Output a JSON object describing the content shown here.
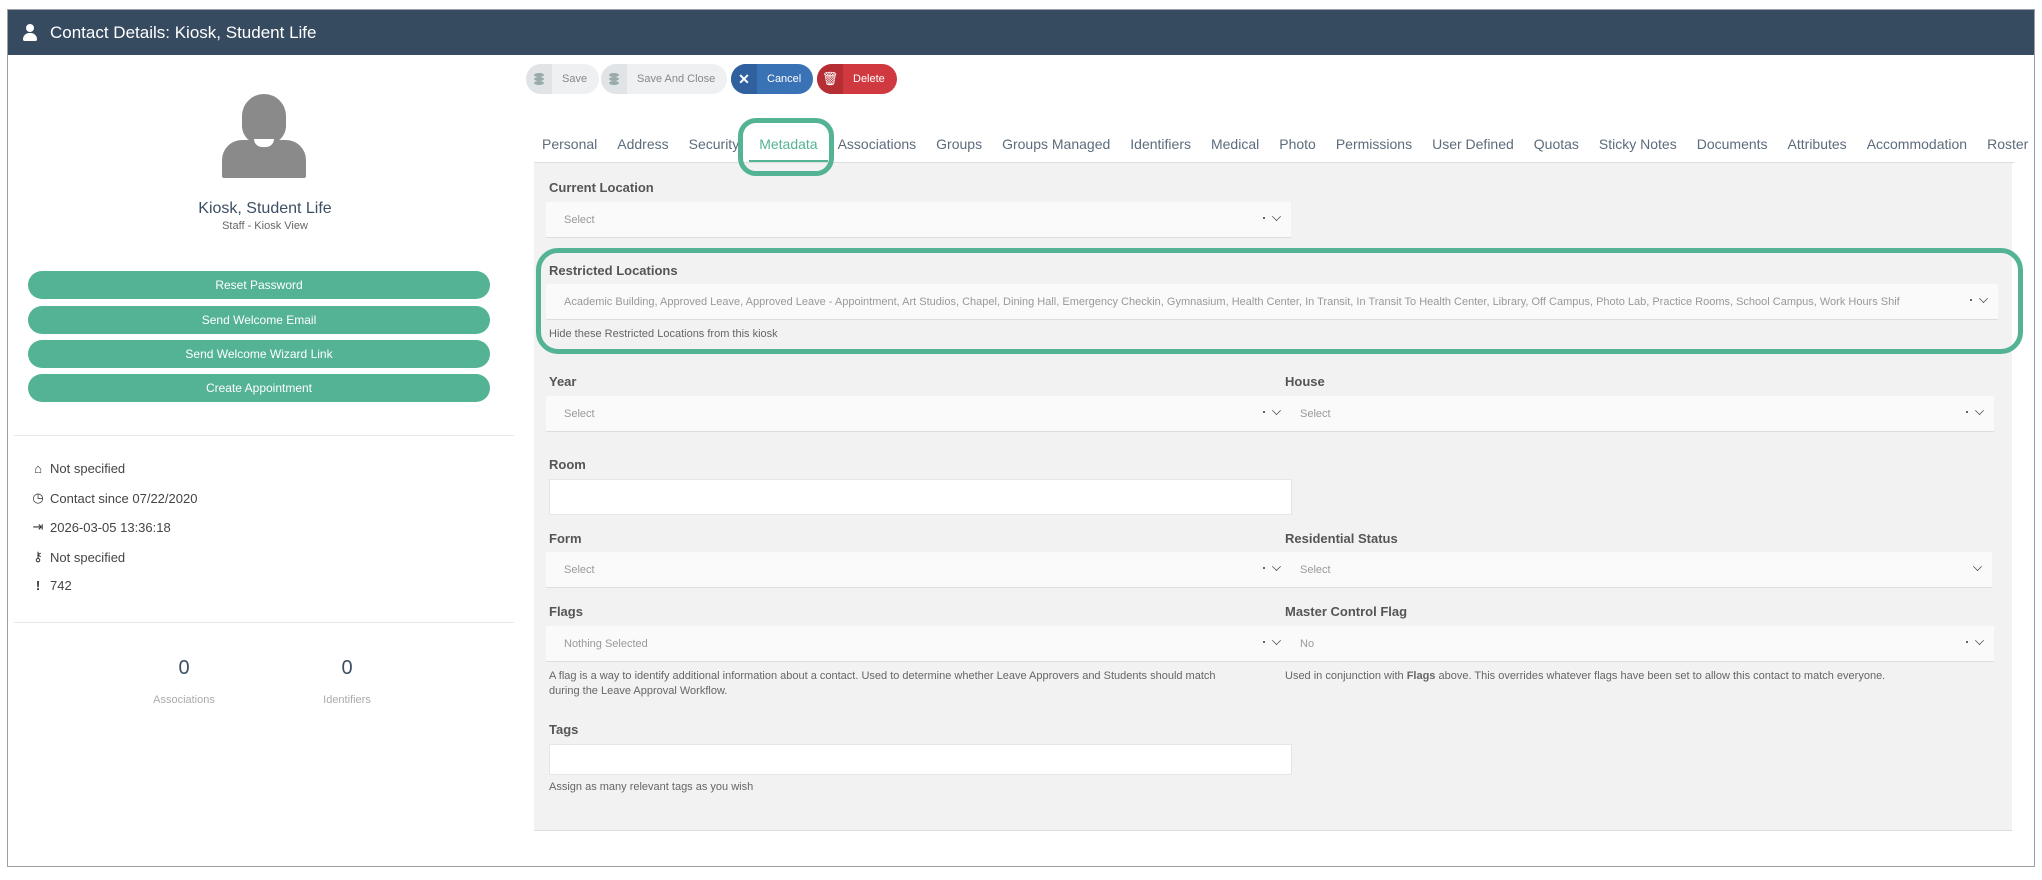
{
  "window": {
    "title": "Contact Details: Kiosk, Student Life"
  },
  "profile": {
    "name": "Kiosk, Student Life",
    "role": "Staff - Kiosk View"
  },
  "actions": [
    {
      "label": "Reset Password"
    },
    {
      "label": "Send Welcome Email"
    },
    {
      "label": "Send Welcome Wizard Link"
    },
    {
      "label": "Create Appointment"
    }
  ],
  "info": [
    {
      "icon": "home-icon",
      "text": "Not specified"
    },
    {
      "icon": "clock-icon",
      "text": "Contact since 07/22/2020"
    },
    {
      "icon": "sign-in-icon",
      "text": "2026-03-05 13:36:18"
    },
    {
      "icon": "key-icon",
      "text": "Not specified"
    },
    {
      "icon": "exclamation-icon",
      "text": "742"
    }
  ],
  "stats": [
    {
      "value": "0",
      "label": "Associations"
    },
    {
      "value": "0",
      "label": "Identifiers"
    }
  ],
  "toolbar": {
    "save": "Save",
    "save_close": "Save And Close",
    "cancel": "Cancel",
    "delete": "Delete"
  },
  "tabs": [
    "Personal",
    "Address",
    "Security",
    "Metadata",
    "Associations",
    "Groups",
    "Groups Managed",
    "Identifiers",
    "Medical",
    "Photo",
    "Permissions",
    "User Defined",
    "Quotas",
    "Sticky Notes",
    "Documents",
    "Attributes",
    "Accommodation",
    "Roster"
  ],
  "active_tab": "Metadata",
  "form": {
    "current_location": {
      "label": "Current Location",
      "value": "Select"
    },
    "restricted_locations": {
      "label": "Restricted Locations",
      "value": "Academic Building, Approved Leave, Approved Leave - Appointment, Art Studios, Chapel, Dining Hall, Emergency Checkin, Gymnasium, Health Center, In Transit, In Transit To Health Center, Library, Off Campus, Photo Lab, Practice Rooms, School Campus, Work Hours Shif",
      "help": "Hide these Restricted Locations from this kiosk"
    },
    "year": {
      "label": "Year",
      "value": "Select"
    },
    "house": {
      "label": "House",
      "value": "Select"
    },
    "room": {
      "label": "Room",
      "value": ""
    },
    "form": {
      "label": "Form",
      "value": "Select"
    },
    "residential_status": {
      "label": "Residential Status",
      "value": "Select"
    },
    "flags": {
      "label": "Flags",
      "value": "Nothing Selected",
      "help": "A flag is a way to identify additional information about a contact. Used to determine whether Leave Approvers and Students should match during the Leave Approval Workflow."
    },
    "master_control_flag": {
      "label": "Master Control Flag",
      "value": "No",
      "help_pre": "Used in conjunction with ",
      "help_bold": "Flags",
      "help_post": " above. This overrides whatever flags have been set to allow this contact to match everyone."
    },
    "tags": {
      "label": "Tags",
      "value": "",
      "help": "Assign as many relevant tags as you wish"
    }
  },
  "colors": {
    "header": "#364a60",
    "accent": "#54b295",
    "cancel": "#3a72b6",
    "delete": "#d0393f"
  }
}
